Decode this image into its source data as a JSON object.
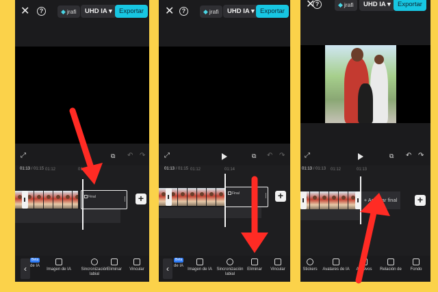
{
  "toolbar": {
    "close_icon": "close-icon",
    "help_icon": "help-icon",
    "pro_badge": "jrafi",
    "quality": "UHD IA",
    "export_label": "Exportar"
  },
  "panels": [
    {
      "timecode_current": "01:13",
      "timecode_total": "/ 01:15",
      "ticks": [
        "01:12",
        "01:13"
      ],
      "final_label": "Final",
      "tools": [
        "de IA",
        "Imagen de IA",
        "Sincronización labial",
        "Eliminar",
        "Vincular"
      ],
      "beta": "Beta"
    },
    {
      "timecode_current": "01:13",
      "timecode_total": "/ 01:15",
      "ticks": [
        "01:12",
        "01:14"
      ],
      "final_label": "Final",
      "tools": [
        "de IA",
        "Imagen de IA",
        "Sincronización labial",
        "Eliminar",
        "Vincular"
      ],
      "beta": "Beta"
    },
    {
      "timecode_current": "01:13",
      "timecode_total": "/ 01:13",
      "ticks": [
        "01:12",
        "01:13"
      ],
      "add_end_label": "+ Agregar final",
      "tools": [
        "Stickers",
        "Avatares de IA",
        "Archivos",
        "Relación de",
        "Fondo"
      ]
    }
  ],
  "colors": {
    "accent": "#17c6e2",
    "arrow": "#ff2b24",
    "background": "#fbd24a"
  }
}
